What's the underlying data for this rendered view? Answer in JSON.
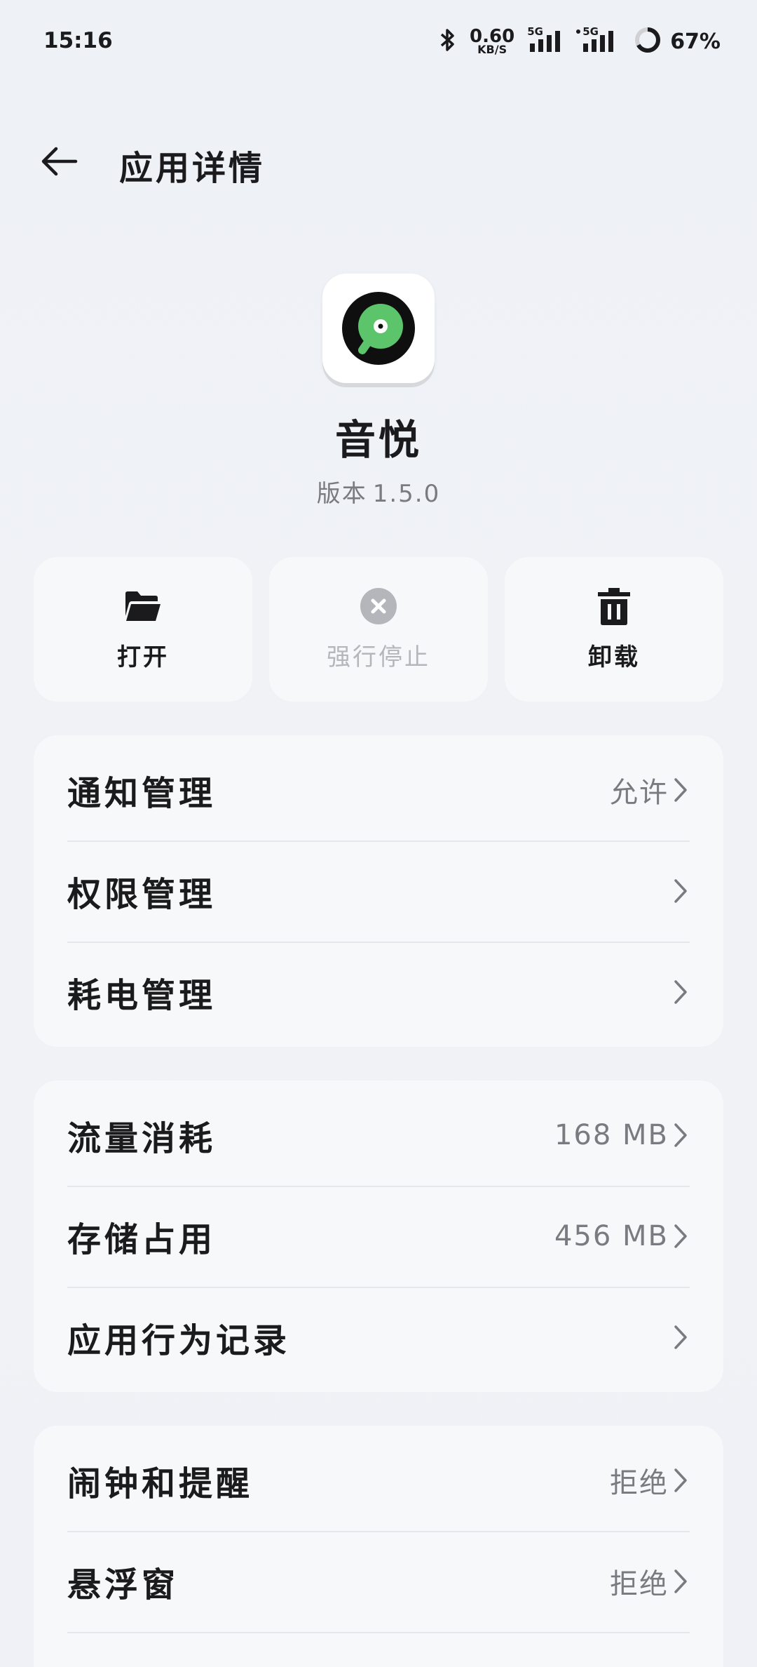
{
  "status_bar": {
    "time": "15:16",
    "net_speed_value": "0.60",
    "net_speed_unit": "KB/S",
    "sim1_label": "5G",
    "sim2_label": "5G",
    "battery_percent": "67%",
    "battery_level": 0.67,
    "icons": [
      "bluetooth-icon",
      "signal-icon",
      "signal-icon",
      "battery-ring-icon"
    ]
  },
  "header": {
    "title": "应用详情",
    "back_icon": "arrow-left-icon"
  },
  "app": {
    "name": "音悦",
    "version_label": "版本",
    "version_number": "1.5.0",
    "icon": "vinyl-record-icon",
    "icon_accent": "#5cc46a"
  },
  "actions": [
    {
      "label": "打开",
      "icon": "folder-open-icon",
      "enabled": true
    },
    {
      "label": "强行停止",
      "icon": "close-circle-icon",
      "enabled": false
    },
    {
      "label": "卸载",
      "icon": "trash-icon",
      "enabled": true
    }
  ],
  "section1": [
    {
      "label": "通知管理",
      "value": "允许"
    },
    {
      "label": "权限管理",
      "value": ""
    },
    {
      "label": "耗电管理",
      "value": ""
    }
  ],
  "section2": [
    {
      "label": "流量消耗",
      "value": "168 MB"
    },
    {
      "label": "存储占用",
      "value": "456 MB"
    },
    {
      "label": "应用行为记录",
      "value": ""
    }
  ],
  "section3": [
    {
      "label": "闹钟和提醒",
      "value": "拒绝"
    },
    {
      "label": "悬浮窗",
      "value": "拒绝"
    }
  ],
  "colors": {
    "background": "#eef1f6",
    "card": "#f7f8fa",
    "text_primary": "#1b1b1d",
    "text_secondary": "#7a7b80",
    "disabled": "#b5b6bb",
    "divider": "#e6e7ea"
  }
}
